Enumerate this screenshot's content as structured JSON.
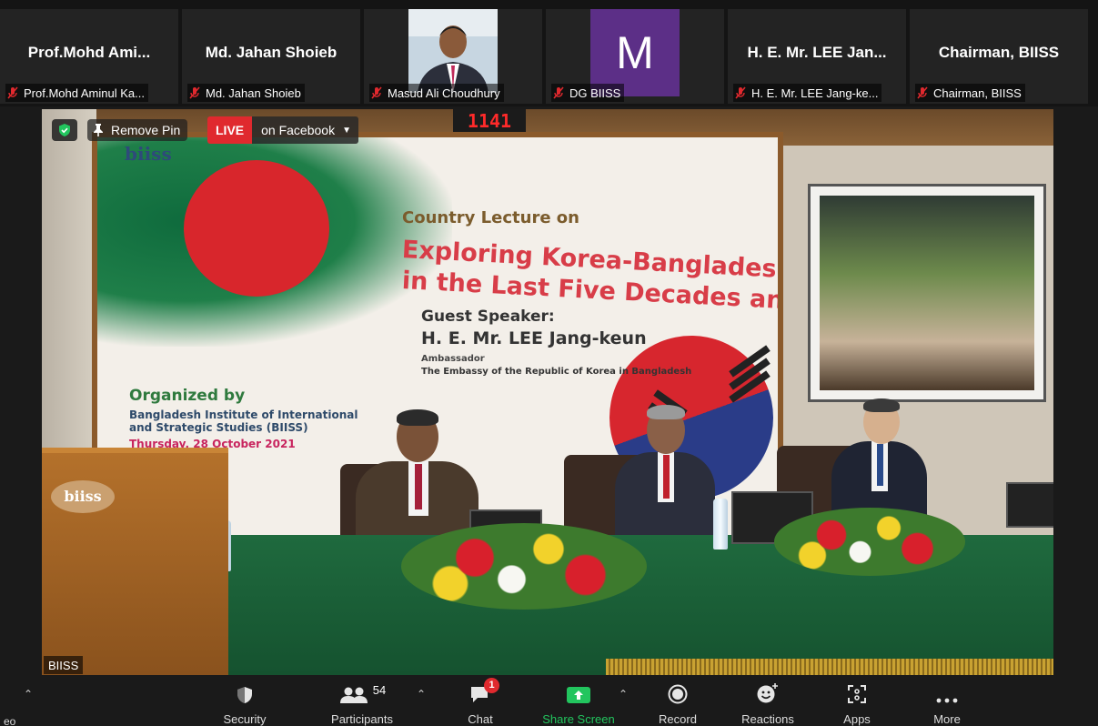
{
  "participants": [
    {
      "display_name": "Prof.Mohd  Ami...",
      "label": "Prof.Mohd Aminul Ka...",
      "type": "name"
    },
    {
      "display_name": "Md. Jahan Shoieb",
      "label": "Md. Jahan Shoieb",
      "type": "name"
    },
    {
      "display_name": "",
      "label": "Masud Ali Choudhury",
      "type": "video"
    },
    {
      "display_name": "M",
      "label": "DG BIISS",
      "type": "avatar"
    },
    {
      "display_name": "H. E. Mr. LEE Jan...",
      "label": "H. E. Mr. LEE Jang-ke...",
      "type": "name"
    },
    {
      "display_name": "Chairman, BIISS",
      "label": "Chairman, BIISS",
      "type": "name"
    }
  ],
  "overlay": {
    "remove_pin": "Remove Pin",
    "live": "LIVE",
    "live_target": "on Facebook",
    "speaker_name": "BIISS"
  },
  "scene": {
    "clock": "1141",
    "banner": {
      "country_lecture": "Country Lecture on",
      "title_line1": "Exploring Korea-Bangladesh Relations",
      "title_line2": "in the Last Five Decades and Beyond",
      "guest_speaker": "Guest Speaker:",
      "speaker": "H. E. Mr. LEE Jang-keun",
      "ambassador": "Ambassador",
      "embassy": "The Embassy of the Republic of Korea in Bangladesh",
      "organized_by": "Organized by",
      "org_line1": "Bangladesh Institute of International",
      "org_line2": "and Strategic Studies (BIISS)",
      "date": "Thursday, 28 October 2021",
      "logo": "biiss"
    },
    "podium_logo": "biiss"
  },
  "toolbar": {
    "video_label": "eo",
    "security": "Security",
    "participants": "Participants",
    "participants_count": "54",
    "chat": "Chat",
    "chat_badge": "1",
    "share_screen": "Share Screen",
    "record": "Record",
    "reactions": "Reactions",
    "apps": "Apps",
    "more": "More"
  },
  "colors": {
    "live_red": "#e0292e",
    "share_green": "#22c55e",
    "avatar_purple": "#5c2f87",
    "toolbar_bg": "#1a1a1a"
  }
}
